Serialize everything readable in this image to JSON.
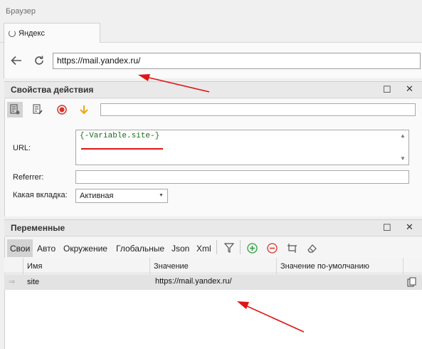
{
  "browser": {
    "panel_title": "Браузер",
    "tab_label": "Яндекс",
    "url": "https://mail.yandex.ru/"
  },
  "properties": {
    "title": "Свойства действия",
    "url_label": "URL:",
    "url_value": "{-Variable.site-}",
    "referrer_label": "Referrer:",
    "referrer_value": "",
    "tab_label": "Какая вкладка:",
    "tab_value": "Активная"
  },
  "variables": {
    "title": "Переменные",
    "tabs": [
      "Свои",
      "Авто",
      "Окружение",
      "Глобальные",
      "Json",
      "Xml"
    ],
    "columns": [
      "Имя",
      "Значение",
      "Значение по-умолчанию"
    ],
    "rows": [
      {
        "name": "site",
        "value": "https://mail.yandex.ru/",
        "default": ""
      }
    ]
  },
  "colors": {
    "annotation": "#e01515",
    "add": "#2e9e3e",
    "remove": "#d9342b"
  }
}
